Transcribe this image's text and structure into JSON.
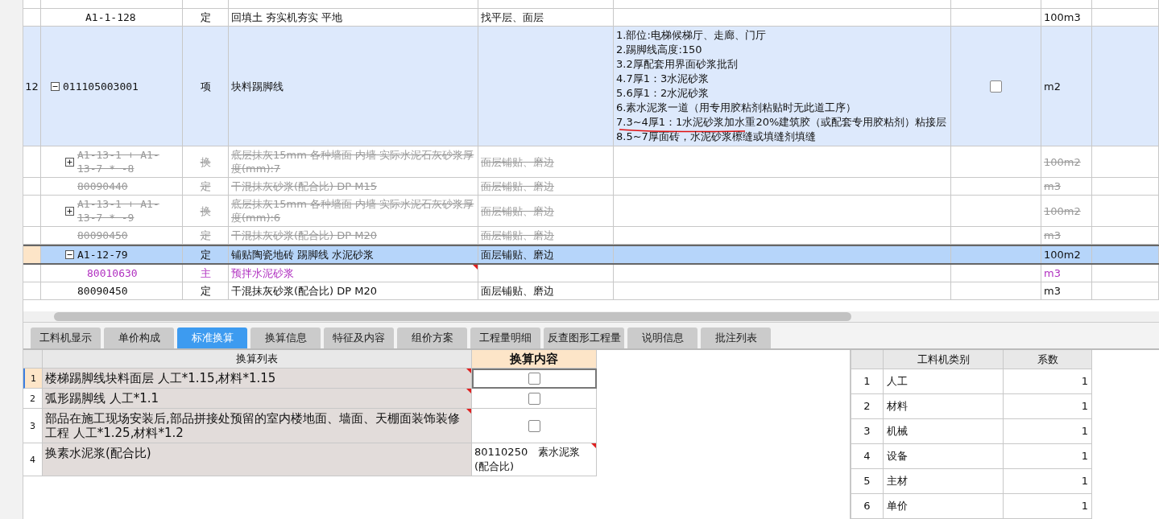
{
  "grid": {
    "rows": [
      {
        "kind": "quota",
        "code": "A1-1-128",
        "type": "定",
        "name": "回填土 夯实机夯实 平地",
        "feature": "找平层、面层",
        "unit": "100m3",
        "disabled": false,
        "selected": false
      },
      {
        "kind": "item",
        "number": "12",
        "code": "011105003001",
        "expanded": true,
        "type": "项",
        "name": "块料踢脚线",
        "feature_lines": [
          {
            "text": "1.部位:电梯候梯厅、走廊、门厅",
            "underlined": false
          },
          {
            "text": "2.踢脚线高度:150",
            "underlined": false
          },
          {
            "text": "3.2厚配套用界面砂浆批刮",
            "underlined": false
          },
          {
            "text": "4.7厚1：3水泥砂浆",
            "underlined": false
          },
          {
            "text": "5.6厚1：2水泥砂浆",
            "underlined": false
          },
          {
            "text": "6.素水泥浆一道（用专用胶粘剂粘贴时无此道工序）",
            "underlined": false
          },
          {
            "text": "7.3~4厚1：1水泥砂浆加水重20%建筑胶（或配套专用胶粘剂）粘接层",
            "underlined": true
          },
          {
            "text": "8.5~7厚面砖，水泥砂浆檫缝或填缝剂填缝",
            "underlined": false
          }
        ],
        "checked": false,
        "unit": "m2",
        "disabled": false,
        "selected": false,
        "children": [
          {
            "kind": "quota",
            "code": "A1-13-1 + A1-13-7 * -8",
            "expanded": false,
            "type": "换",
            "name": "底层抹灰15mm 各种墙面 内墙  实际水泥石灰砂浆厚度(mm):7",
            "feature": "面层铺贴、磨边",
            "unit": "100m2",
            "disabled": true,
            "selected": false
          },
          {
            "kind": "quota",
            "code": "80090440",
            "type": "定",
            "name": "干混抹灰砂浆(配合比) DP M15",
            "feature": "面层铺贴、磨边",
            "unit": "m3",
            "disabled": true,
            "selected": false
          },
          {
            "kind": "quota",
            "code": "A1-13-1 + A1-13-7 * -9",
            "expanded": false,
            "type": "换",
            "name": "底层抹灰15mm 各种墙面 内墙  实际水泥石灰砂浆厚度(mm):6",
            "feature": "面层铺贴、磨边",
            "unit": "100m2",
            "disabled": true,
            "selected": false
          },
          {
            "kind": "quota",
            "code": "80090450",
            "type": "定",
            "name": "干混抹灰砂浆(配合比) DP M20",
            "feature": "面层铺贴、磨边",
            "unit": "m3",
            "disabled": true,
            "selected": false
          },
          {
            "kind": "quota",
            "code": "A1-12-79",
            "expanded": true,
            "type": "定",
            "name": "铺贴陶瓷地砖 踢脚线 水泥砂浆",
            "feature": "面层铺贴、磨边",
            "unit": "100m2",
            "disabled": false,
            "selected": true,
            "children": [
              {
                "kind": "material",
                "code": "80010630",
                "type": "主",
                "name": "预拌水泥砂浆",
                "flagged": true,
                "unit": "m3",
                "disabled": false,
                "selected": false
              }
            ]
          },
          {
            "kind": "quota",
            "code": "80090450",
            "type": "定",
            "name": "干混抹灰砂浆(配合比) DP M20",
            "feature": "面层铺贴、磨边",
            "unit": "m3",
            "disabled": false,
            "selected": false
          }
        ]
      }
    ]
  },
  "tabs": [
    {
      "label": "工料机显示",
      "selected": false
    },
    {
      "label": "单价构成",
      "selected": false
    },
    {
      "label": "标准换算",
      "selected": true
    },
    {
      "label": "换算信息",
      "selected": false
    },
    {
      "label": "特征及内容",
      "selected": false
    },
    {
      "label": "组价方案",
      "selected": false
    },
    {
      "label": "工程量明细",
      "selected": false
    },
    {
      "label": "反查图形工程量",
      "selected": false
    },
    {
      "label": "说明信息",
      "selected": false
    },
    {
      "label": "批注列表",
      "selected": false
    }
  ],
  "conversion_table": {
    "columns": [
      "换算列表",
      "换算内容"
    ],
    "rows": [
      {
        "number": "1",
        "name": "楼梯踢脚线块料面层 人工*1.15,材料*1.15",
        "kind": "checkbox",
        "checked": false,
        "flagged": true,
        "selected": true
      },
      {
        "number": "2",
        "name": "弧形踢脚线 人工*1.1",
        "kind": "checkbox",
        "checked": false,
        "flagged": true,
        "selected": false
      },
      {
        "number": "3",
        "name": "部品在施工现场安装后,部品拼接处预留的室内楼地面、墙面、天棚面装饰装修工程 人工*1.25,材料*1.2",
        "kind": "checkbox",
        "checked": false,
        "flagged": true,
        "selected": false
      },
      {
        "number": "4",
        "name": "换素水泥浆(配合比)",
        "kind": "text",
        "content": "80110250　素水泥浆(配合比)",
        "content_flagged": true,
        "flagged": false,
        "selected": false
      }
    ]
  },
  "coefficient_table": {
    "columns": [
      "工料机类别",
      "系数"
    ],
    "rows": [
      {
        "number": "1",
        "category": "人工",
        "coefficient": "1"
      },
      {
        "number": "2",
        "category": "材料",
        "coefficient": "1"
      },
      {
        "number": "3",
        "category": "机械",
        "coefficient": "1"
      },
      {
        "number": "4",
        "category": "设备",
        "coefficient": "1"
      },
      {
        "number": "5",
        "category": "主材",
        "coefficient": "1"
      },
      {
        "number": "6",
        "category": "单价",
        "coefficient": "1"
      }
    ]
  }
}
